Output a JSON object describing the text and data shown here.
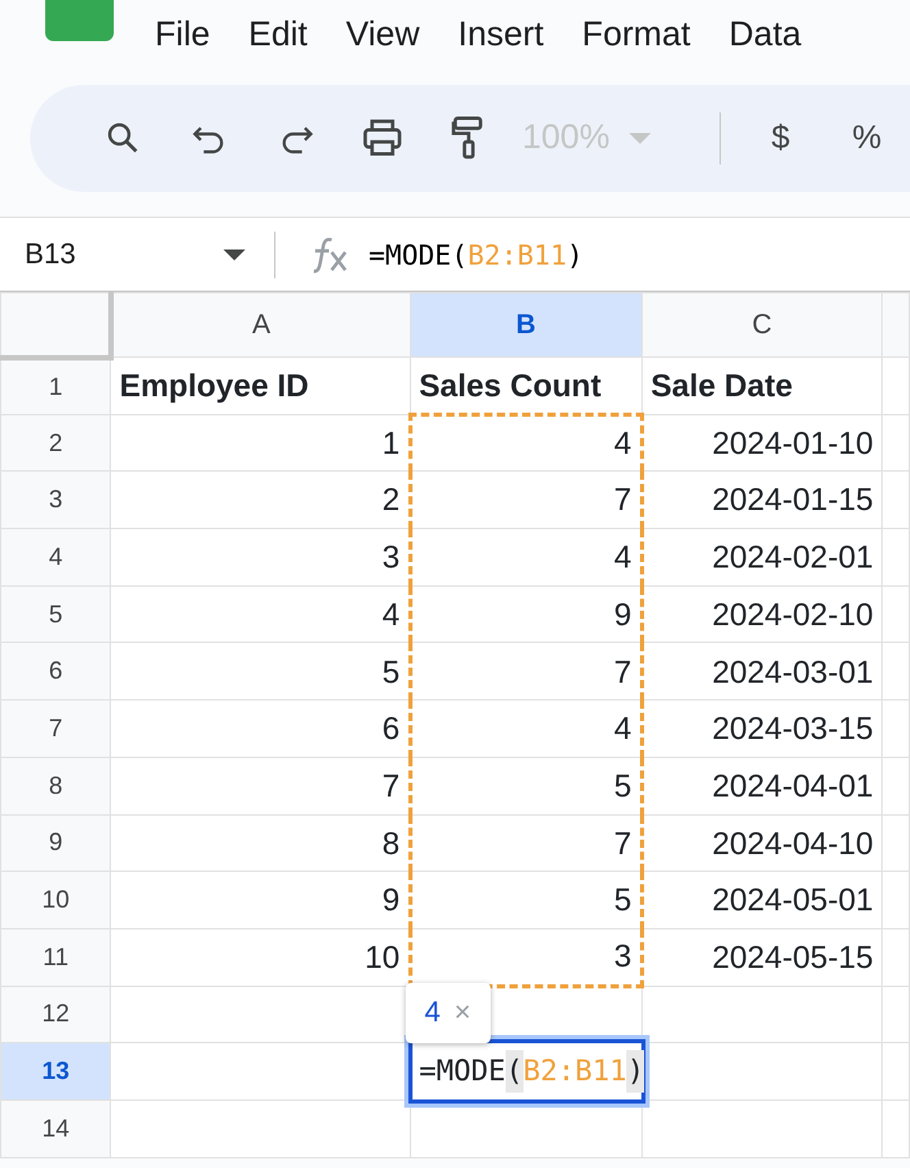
{
  "menu": [
    "File",
    "Edit",
    "View",
    "Insert",
    "Format",
    "Data"
  ],
  "toolbar": {
    "zoom": {
      "value": "100%",
      "disabled": true
    },
    "currency": "$",
    "percent": "%"
  },
  "formula_bar": {
    "name_box": "B13",
    "formula": [
      {
        "kind": "plain",
        "text": "=MODE("
      },
      {
        "kind": "ref",
        "text": "B2:B11"
      },
      {
        "kind": "plain",
        "text": ")"
      }
    ]
  },
  "columns": [
    {
      "label": "A",
      "selected": false
    },
    {
      "label": "B",
      "selected": true
    },
    {
      "label": "C",
      "selected": false
    }
  ],
  "rows": [
    {
      "number": "1",
      "selected": false,
      "kind": "header",
      "cells": [
        {
          "text": "Employee ID"
        },
        {
          "text": "Sales Count"
        },
        {
          "text": "Sale Date"
        }
      ]
    },
    {
      "number": "2",
      "selected": false,
      "kind": "data",
      "cells": [
        {
          "text": "1"
        },
        {
          "text": "4",
          "in_range": true
        },
        {
          "text": "2024-01-10"
        }
      ]
    },
    {
      "number": "3",
      "selected": false,
      "kind": "data",
      "cells": [
        {
          "text": "2"
        },
        {
          "text": "7",
          "in_range": true
        },
        {
          "text": "2024-01-15"
        }
      ]
    },
    {
      "number": "4",
      "selected": false,
      "kind": "data",
      "cells": [
        {
          "text": "3"
        },
        {
          "text": "4",
          "in_range": true
        },
        {
          "text": "2024-02-01"
        }
      ]
    },
    {
      "number": "5",
      "selected": false,
      "kind": "data",
      "cells": [
        {
          "text": "4"
        },
        {
          "text": "9",
          "in_range": true
        },
        {
          "text": "2024-02-10"
        }
      ]
    },
    {
      "number": "6",
      "selected": false,
      "kind": "data",
      "cells": [
        {
          "text": "5"
        },
        {
          "text": "7",
          "in_range": true
        },
        {
          "text": "2024-03-01"
        }
      ]
    },
    {
      "number": "7",
      "selected": false,
      "kind": "data",
      "cells": [
        {
          "text": "6"
        },
        {
          "text": "4",
          "in_range": true
        },
        {
          "text": "2024-03-15"
        }
      ]
    },
    {
      "number": "8",
      "selected": false,
      "kind": "data",
      "cells": [
        {
          "text": "7"
        },
        {
          "text": "5",
          "in_range": true
        },
        {
          "text": "2024-04-01"
        }
      ]
    },
    {
      "number": "9",
      "selected": false,
      "kind": "data",
      "cells": [
        {
          "text": "8"
        },
        {
          "text": "7",
          "in_range": true
        },
        {
          "text": "2024-04-10"
        }
      ]
    },
    {
      "number": "10",
      "selected": false,
      "kind": "data",
      "cells": [
        {
          "text": "9"
        },
        {
          "text": "5",
          "in_range": true
        },
        {
          "text": "2024-05-01"
        }
      ]
    },
    {
      "number": "11",
      "selected": false,
      "kind": "data",
      "cells": [
        {
          "text": "10"
        },
        {
          "text": "3",
          "in_range": true
        },
        {
          "text": "2024-05-15"
        }
      ]
    },
    {
      "number": "12",
      "selected": false,
      "kind": "data",
      "cells": [
        {
          "text": ""
        },
        {
          "text": ""
        },
        {
          "text": ""
        }
      ]
    },
    {
      "number": "13",
      "selected": true,
      "kind": "data",
      "cells": [
        {
          "text": ""
        },
        {
          "editing": true,
          "editor": [
            {
              "kind": "plain",
              "text": "=MODE"
            },
            {
              "kind": "paren",
              "text": "("
            },
            {
              "kind": "ref",
              "text": "B2:B11"
            },
            {
              "kind": "paren",
              "text": ")"
            }
          ]
        },
        {
          "text": ""
        }
      ]
    },
    {
      "number": "14",
      "selected": false,
      "kind": "data",
      "cells": [
        {
          "text": ""
        },
        {
          "text": ""
        },
        {
          "text": ""
        }
      ]
    }
  ],
  "result_tooltip": {
    "value": "4",
    "close": "×"
  }
}
